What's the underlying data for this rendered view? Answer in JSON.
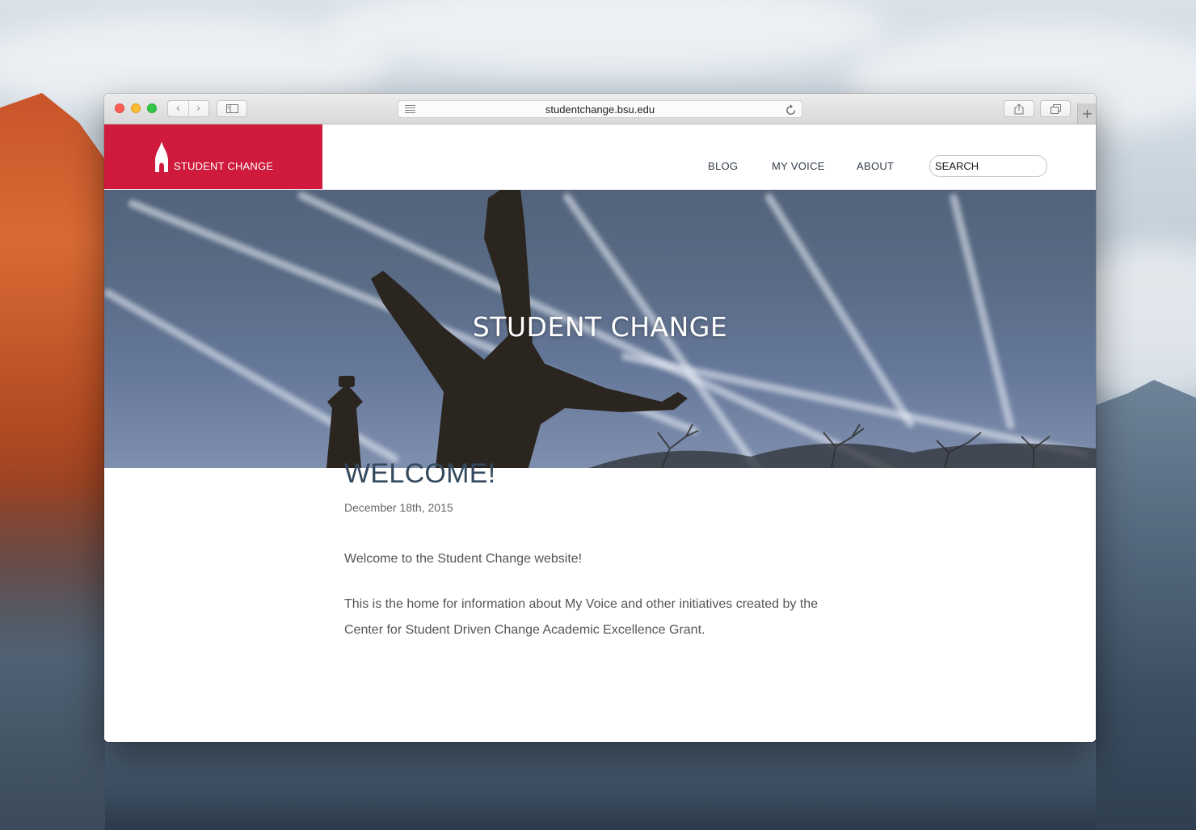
{
  "browser": {
    "url": "studentchange.bsu.edu",
    "back_glyph": "‹",
    "forward_glyph": "›",
    "new_tab_glyph": "+"
  },
  "site": {
    "brand_name": "STUDENT CHANGE",
    "brand_color": "#cf1a3d",
    "nav": {
      "blog": "BLOG",
      "my_voice": "MY VOICE",
      "about": "ABOUT"
    },
    "search": {
      "placeholder": "SEARCH"
    },
    "hero": {
      "title": "STUDENT CHANGE"
    },
    "post": {
      "title": "WELCOME!",
      "date": "December 18th, 2015",
      "paragraphs": [
        "Welcome to the Student Change website!",
        "This is the home for information about My Voice and other initiatives created by the Center for Student Driven Change Academic Excellence Grant."
      ]
    }
  },
  "icons": {
    "close": "close-dot-icon",
    "minimize": "minimize-dot-icon",
    "maximize": "maximize-dot-icon",
    "sidebar": "sidebar-icon",
    "reader": "reader-icon",
    "reload": "reload-icon",
    "share": "share-icon",
    "tabs": "tabs-overview-icon",
    "logo": "flame-logo-icon"
  }
}
